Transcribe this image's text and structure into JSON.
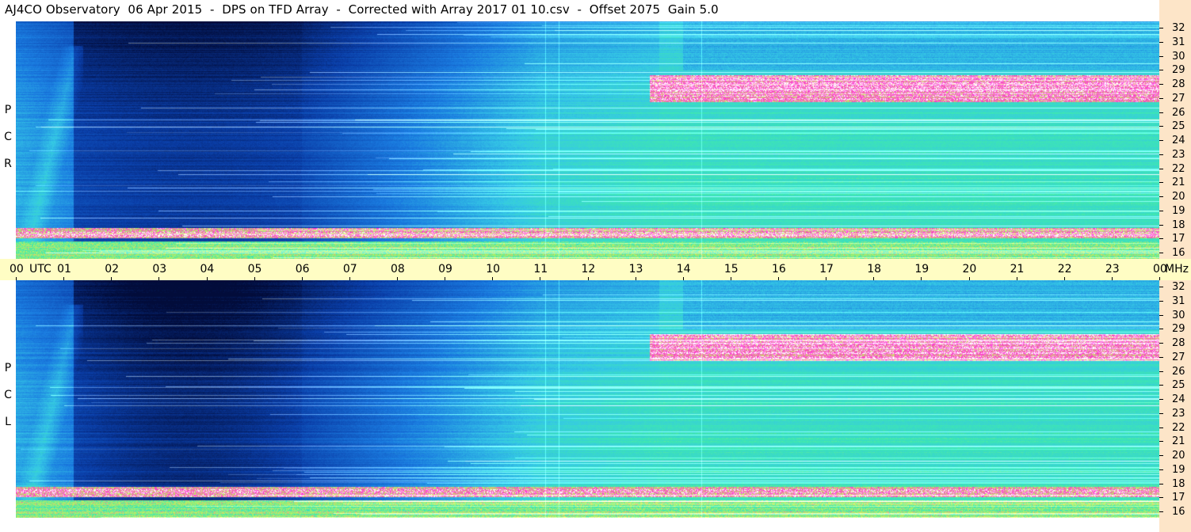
{
  "title": "AJ4CO Observatory  06 Apr 2015  -  DPS on TFD Array  -  Corrected with Array 2017 01 10.csv  -  Offset 2075  Gain 5.0",
  "chart_data": [
    {
      "type": "heatmap",
      "panel": "top",
      "polarization_label": [
        "R",
        "C",
        "P"
      ],
      "x_range_utc_hours": [
        0,
        24
      ],
      "y_range_mhz": [
        16,
        32
      ],
      "y_ticks": [
        "32",
        "31",
        "30",
        "29",
        "28",
        "27",
        "26",
        "25",
        "24",
        "23",
        "22",
        "21",
        "20",
        "19",
        "18",
        "17",
        "16"
      ]
    },
    {
      "type": "heatmap",
      "panel": "bottom",
      "polarization_label": [
        "L",
        "C",
        "P"
      ],
      "x_range_utc_hours": [
        0,
        24
      ],
      "y_range_mhz": [
        16,
        32
      ],
      "y_ticks": [
        "32",
        "31",
        "30",
        "29",
        "28",
        "27",
        "26",
        "25",
        "24",
        "23",
        "22",
        "21",
        "20",
        "19",
        "18",
        "17",
        "16"
      ]
    }
  ],
  "time_axis": {
    "labels": [
      "00",
      "01",
      "02",
      "03",
      "04",
      "05",
      "06",
      "07",
      "08",
      "09",
      "10",
      "11",
      "12",
      "13",
      "14",
      "15",
      "16",
      "17",
      "18",
      "19",
      "20",
      "21",
      "22",
      "23",
      "00"
    ],
    "utc_label": "UTC",
    "mhz_label": "MHz"
  },
  "colors": {
    "deep": "#020c3a",
    "low": "#0a3ea8",
    "mid_low": "#1a7be0",
    "mid": "#35c8e6",
    "mid_high": "#3ee8b0",
    "high": "#c8f05a",
    "peak": "#ff2fd0",
    "saturated": "#ffffff",
    "axis_bg": "#fde5c8",
    "time_bar_bg": "#fffdc4"
  }
}
